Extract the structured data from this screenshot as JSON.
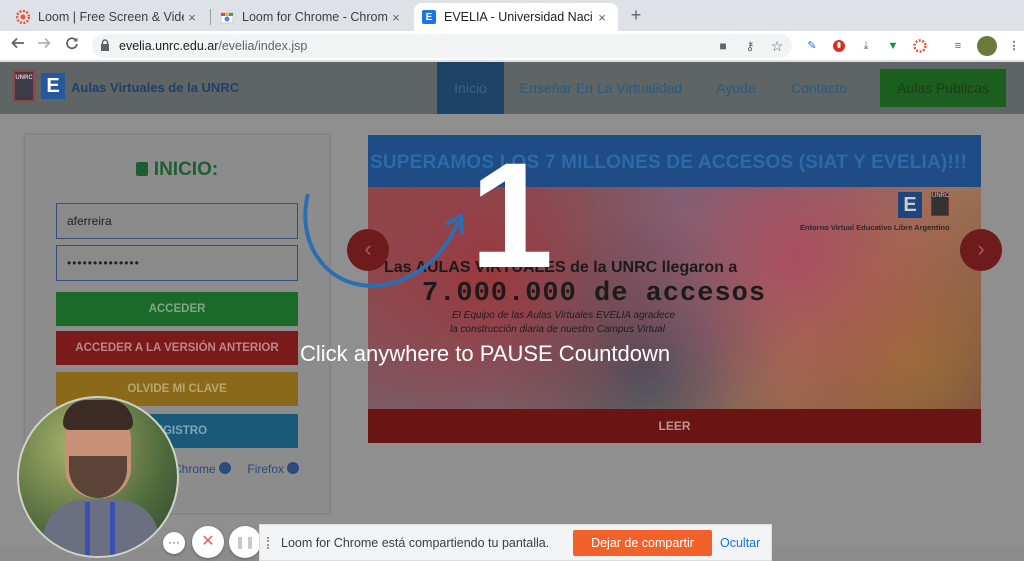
{
  "browser": {
    "tabs": [
      {
        "title": "Loom | Free Screen & Vide",
        "icon": "loom-icon"
      },
      {
        "title": "Loom for Chrome - Chrom",
        "icon": "chrome-web-store-icon"
      },
      {
        "title": "EVELIA - Universidad Naci",
        "icon": "evelia-e-icon",
        "fav_letter": "E",
        "active": true
      }
    ],
    "new_tab": "+",
    "close": "×",
    "url_host": "evelia.unrc.edu.ar",
    "url_path": "/evelia/index.jsp"
  },
  "site": {
    "logo_unrc": "UNRC",
    "logo_e": "E",
    "brand": "Aulas Virtuales de la UNRC",
    "nav": [
      "Inicio",
      "Enseñar En La Virtualidad",
      "Ayuda",
      "Contacto"
    ],
    "nav_public": "Aulas Publicas"
  },
  "login": {
    "title": "INICIO:",
    "username": "aferreira",
    "password_mask": "••••••••••••••",
    "btn_acceder": "ACCEDER",
    "btn_anterior": "ACCEDER A LA VERSIÓN ANTERIOR",
    "btn_olvide": "OLVIDE MI CLAVE",
    "btn_registro": "REGISTRO",
    "link_chrome": "Chrome",
    "link_firefox": "Firefox"
  },
  "carousel": {
    "banner": "SUPERAMOS LOS 7 MILLONES DE ACCESOS (SIAT Y EVELIA)!!!",
    "line1": "Las AULAS VIRTUALES de la UNRC llegaron a",
    "line2": "7.000.000 de accesos",
    "line3": "El Equipo de las Aulas Virtuales EVELIA agradece",
    "line4": "la construcción diaria de nuestro Campus Virtual",
    "sub": "Entorno Virtual Educativo Libre Argentino",
    "read_more": "LEER",
    "prev": "‹",
    "next": "›"
  },
  "overlay": {
    "countdown": "1",
    "message": "Click anywhere to PAUSE Countdown"
  },
  "loom": {
    "more": "···",
    "cancel": "✕",
    "pause": "❚❚"
  },
  "share_bar": {
    "message": "Loom for Chrome está compartiendo tu pantalla.",
    "stop": "Dejar de compartir",
    "hide": "Ocultar"
  },
  "colors": {
    "accent_blue": "#1a73e8",
    "loom_orange": "#f2612a",
    "acceder_green": "#1b6a2a",
    "anterior_red": "#7a1a1a",
    "olvide_orange": "#8a6a1a",
    "registro_blue": "#1a5a78"
  }
}
